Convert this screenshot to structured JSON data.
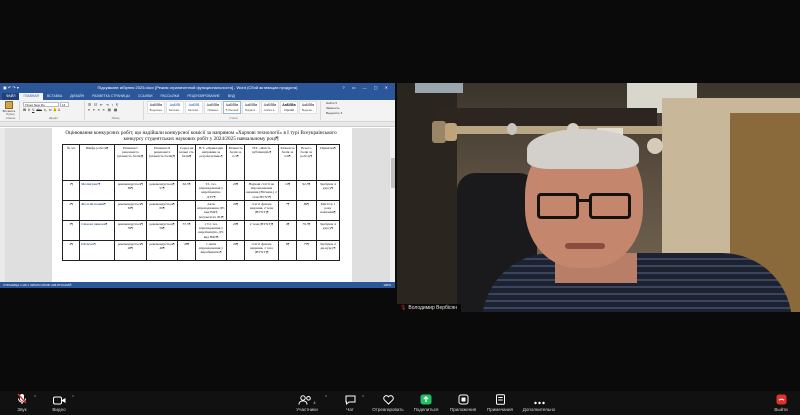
{
  "word": {
    "window_title": "Підсумкове кібірння 2025.docx [Режим ограниченной функциональности] - Word (Сбой активации продукта)",
    "window_controls": "? ▭ — ▢ ✕",
    "tabs": [
      "ФАЙЛ",
      "ГЛАВНАЯ",
      "ВСТАВКА",
      "ДИЗАЙН",
      "РАЗМЕТКА СТРАНИЦЫ",
      "ССЫЛКИ",
      "РАССЫЛКИ",
      "РЕЦЕНЗИРОВАНИЕ",
      "ВИД"
    ],
    "ribbon": {
      "paste_label": "Вставить",
      "clipboard_label": "Буфер обмена",
      "font_name": "Times New Ro",
      "font_size": "14",
      "format_buttons": [
        "Ж",
        "К",
        "Ч",
        "abc",
        "x₂",
        "x²",
        "A",
        "A"
      ],
      "font_group_label": "Шрифт",
      "paragraph_group_label": "Абзац",
      "styles": [
        {
          "sample": "АаБбВв",
          "name": "Выделение"
        },
        {
          "sample": "АаБбВ",
          "name": "Заголово..."
        },
        {
          "sample": "АаБбВ",
          "name": "Заголово..."
        },
        {
          "sample": "АаБбВв",
          "name": "Название"
        },
        {
          "sample": "АаБбВв",
          "name": "¶ Обычный"
        },
        {
          "sample": "АаБбВв",
          "name": "Подзагол..."
        },
        {
          "sample": "АаБбВв",
          "name": "Слабое в..."
        },
        {
          "sample": "АаБбВв",
          "name": "Строгий"
        },
        {
          "sample": "АаБбВв",
          "name": "Выделен..."
        }
      ],
      "styles_group_label": "Стили",
      "editing": [
        "Найти ▾",
        "Заменить",
        "Выделить ▾"
      ],
      "editing_group_label": "Редактирование"
    },
    "document": {
      "title": "Оцінювання конкурсних робіт, що надійшли конкурсної комісії за напрямом «Харчові технології» в І турі Всеукраїнського конкурсу студентських наукових робіт у 2024/2025 навчальному році¶",
      "headers": [
        "№ з/п",
        "Шифр роботи¶",
        "Рішення І рецензента (кількість балів)¶",
        "Рішення ІІ рецензента (кількість балів)¶",
        "Серед ня кількі сть балів¶",
        "Н.Т. «Прикладні напрямки за результатами»¶",
        "Кількість балів за п.5¶",
        "Н.Т. «Якість публікацій»¶",
        "Кількість балів за п.6¶",
        "Всього балів за роботу¶",
        "Примітка¶"
      ],
      "rows": [
        [
          "1¶",
          "Мелінгрант¶",
          "рекомендується¶ 69¶",
          "рекомендується¶ 57¶",
          "62,5¶",
          "Т.І. тез. впровадження у виробництво ДТУ¶",
          "20¶",
          "Наукові статті не впровадження видання (Вітчизн.) 2 тези НУХТ¶",
          "10¶",
          "92,5¶",
          "Здобувач 4 курсу¶"
        ],
        [
          "2¶",
          "Жолі-Цілюший¶",
          "рекомендується¶ 63¶",
          "рекомендується¶ 65¶",
          "",
          "Акти впровадження ДУ, вид ВФЗ, результатах ЛЦ¶",
          "20¶",
          "статті фахове видання, 2 тези (НУХТ)¶",
          "7¶",
          "89¶",
          "Магістр 1 року навчання¶"
        ],
        [
          "3¶",
          "Свіжові шиноки¶",
          "рекомендується¶ 59¶",
          "рекомендується¶ 56¶",
          "57,5¶",
          "1 Т.І. тез. впровадження у виробництво ДУ, вид ВФЗ¶",
          "20¶",
          "2 тези (НУХТ)¶",
          "4¶",
          "79,5¶",
          "Здобувач 4 курсу¶"
        ],
        [
          "4¶",
          "Щ'ємант¶",
          "рекомендується¶ 48¶",
          "рекомендується¶ 48¶",
          "48¶",
          "1 Акти впровадження у виробництво¶",
          "20¶",
          "статті фахове видання, 1 теза (НУХТ)¶",
          "6¶",
          "75¶",
          "Здобувач 2 ди-курсу¶"
        ]
      ]
    },
    "status_left": "СТРАНИЦА 1 ИЗ 1   ЧИСЛО СЛОВ: 206   РУССКИЙ",
    "status_right": "100%"
  },
  "participant_name": "Володимир Вербісян",
  "toolbar": {
    "audio_label": "Звук",
    "video_label": "Видео",
    "participants_label": "Участники",
    "participants_count": "4",
    "chat_label": "Чат",
    "react_label": "Отреагировать",
    "share_label": "Поделиться",
    "apps_label": "Приложения",
    "whiteboards_label": "Примечания",
    "more_label": "Дополнительно",
    "leave_label": "Выйти"
  },
  "colors": {
    "word_blue": "#2b579a",
    "share_green": "#21c063",
    "leave_red": "#e0312b"
  }
}
